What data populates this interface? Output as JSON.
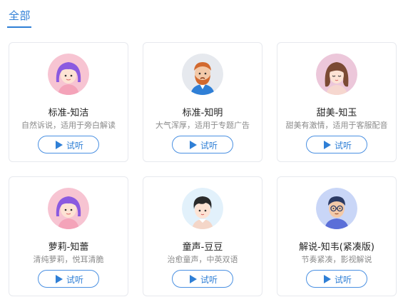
{
  "tabs": {
    "active_label": "全部"
  },
  "voices": [
    {
      "name": "标准-知洁",
      "desc": "自然诉说，适用于旁白解读",
      "listen": "试听",
      "avatar": "girl-purple-hair-avatar"
    },
    {
      "name": "标准-知明",
      "desc": "大气浑厚，适用于专题广告",
      "listen": "试听",
      "avatar": "bearded-man-avatar"
    },
    {
      "name": "甜美-知玉",
      "desc": "甜美有激情，适用于客服配音",
      "listen": "试听",
      "avatar": "woman-brown-hair-avatar"
    },
    {
      "name": "萝莉-知蕾",
      "desc": "清纯萝莉，悦耳清脆",
      "listen": "试听",
      "avatar": "girl-purple-hair-avatar"
    },
    {
      "name": "童声-豆豆",
      "desc": "治愈童声，中英双语",
      "listen": "试听",
      "avatar": "boy-avatar"
    },
    {
      "name": "解说-知韦(紧凑版)",
      "desc": "节奏紧凑，影视解说",
      "listen": "试听",
      "avatar": "man-glasses-avatar"
    }
  ],
  "colors": {
    "accent": "#2f7fd6",
    "card_border": "#e7e9ee",
    "muted_text": "#8a8a8a"
  }
}
